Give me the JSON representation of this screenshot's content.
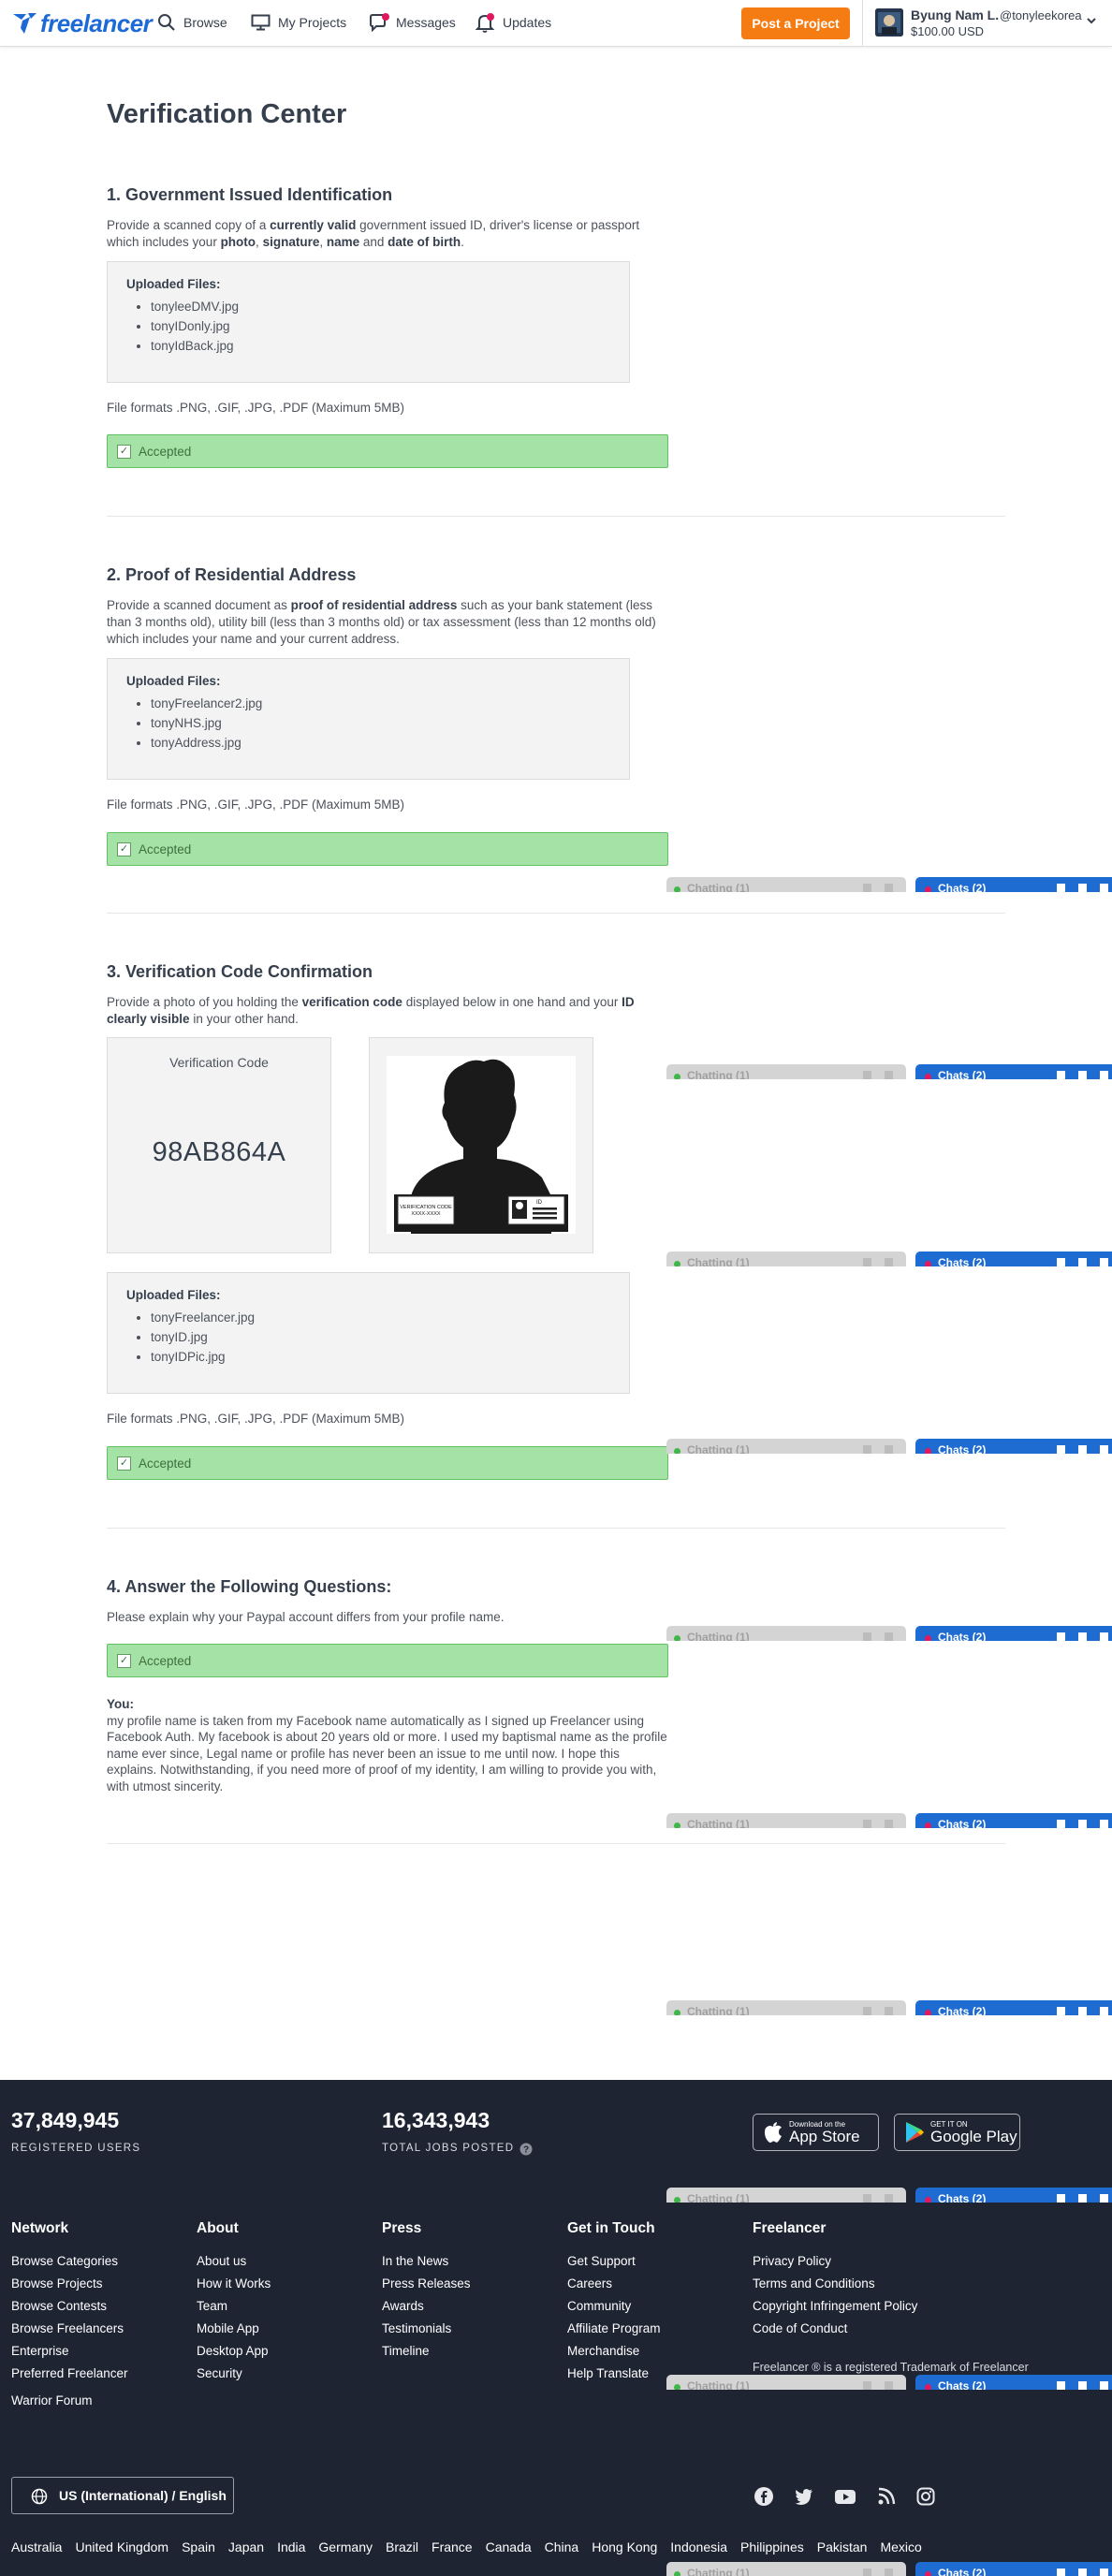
{
  "header": {
    "logo_text": "freelancer",
    "nav": [
      {
        "label": "Browse",
        "icon": "search-icon"
      },
      {
        "label": "My Projects",
        "icon": "monitor-icon"
      },
      {
        "label": "Messages",
        "icon": "chat-bubble-icon"
      },
      {
        "label": "Updates",
        "icon": "bell-icon"
      }
    ],
    "post_button": "Post a Project",
    "user": {
      "name": "Byung Nam L.",
      "handle": "@tonyleekorea",
      "balance": "$100.00 USD"
    }
  },
  "page_title": "Verification Center",
  "sections": {
    "gov_id": {
      "title": "1. Government Issued Identification",
      "desc_1": "Provide a scanned copy of a ",
      "desc_b1": "currently valid",
      "desc_2": " government issued ID, driver's license or passport which includes your ",
      "desc_b2": "photo",
      "desc_3": ", ",
      "desc_b3": "signature",
      "desc_4": ", ",
      "desc_b4": "name",
      "desc_5": " and ",
      "desc_b5": "date of birth",
      "desc_6": ".",
      "files_title": "Uploaded Files:",
      "files": [
        "tonyleeDMV.jpg",
        "tonyIDonly.jpg",
        "tonyIdBack.jpg"
      ],
      "formats": "File formats .PNG, .GIF, .JPG, .PDF (Maximum 5MB)",
      "status": "Accepted"
    },
    "address": {
      "title": "2. Proof of Residential Address",
      "desc_1": "Provide a scanned document as ",
      "desc_b1": "proof of residential address",
      "desc_2": " such as your bank statement (less than 3 months old), utility bill (less than 3 months old) or tax assessment (less than 12 months old) which includes your name and your current address.",
      "files_title": "Uploaded Files:",
      "files": [
        "tonyFreelancer2.jpg",
        "tonyNHS.jpg",
        "tonyAddress.jpg"
      ],
      "formats": "File formats .PNG, .GIF, .JPG, .PDF (Maximum 5MB)",
      "status": "Accepted"
    },
    "code": {
      "title": "3. Verification Code Confirmation",
      "desc_1": "Provide a photo of you holding the ",
      "desc_b1": "verification code",
      "desc_2": " displayed below in one hand and your ",
      "desc_b2": "ID clearly visible",
      "desc_3": " in your other hand.",
      "code_label": "Verification Code",
      "code_value": "98AB864A",
      "example_card_text": "VERIFICATION CODE",
      "example_card_code": "XXXX-XXXX",
      "example_id_text": "ID",
      "files_title": "Uploaded Files:",
      "files": [
        "tonyFreelancer.jpg",
        "tonyID.jpg",
        "tonyIDPic.jpg"
      ],
      "formats": "File formats .PNG, .GIF, .JPG, .PDF (Maximum 5MB)",
      "status": "Accepted"
    },
    "questions": {
      "title": "4. Answer the Following Questions:",
      "question": "Please explain why your Paypal account differs from your profile name.",
      "status": "Accepted",
      "you_label": "You:",
      "answer": "my profile name is taken from my Facebook name automatically as I signed up Freelancer using Facebook Auth. My facebook is about 20 years old or more. I used my baptismal name as the profile name ever since, Legal name or profile has never been an issue to me until now. I hope this explains. Notwithstanding, if you need more of proof of my identity, I am willing to provide you with, with utmost sincerity."
    }
  },
  "chat": {
    "contacts_label": "Chatting (1)",
    "chats_label": "Chats (2)"
  },
  "footer": {
    "stats": [
      {
        "value": "37,849,945",
        "label": "REGISTERED USERS"
      },
      {
        "value": "16,343,943",
        "label": "TOTAL JOBS POSTED"
      }
    ],
    "app_store": {
      "small": "Download on the",
      "big": "App Store"
    },
    "google_play": {
      "small": "GET IT ON",
      "big": "Google Play"
    },
    "columns": [
      {
        "title": "Network",
        "links": [
          "Browse Categories",
          "Browse Projects",
          "Browse Contests",
          "Browse Freelancers",
          "Enterprise",
          "Preferred Freelancer",
          "Warrior Forum"
        ]
      },
      {
        "title": "About",
        "links": [
          "About us",
          "How it Works",
          "Team",
          "Mobile App",
          "Desktop App",
          "Security"
        ]
      },
      {
        "title": "Press",
        "links": [
          "In the News",
          "Press Releases",
          "Awards",
          "Testimonials",
          "Timeline"
        ]
      },
      {
        "title": "Get in Touch",
        "links": [
          "Get Support",
          "Careers",
          "Community",
          "Affiliate Program",
          "Merchandise",
          "Help Translate"
        ]
      },
      {
        "title": "Freelancer",
        "links": [
          "Privacy Policy",
          "Terms and Conditions",
          "Copyright Infringement Policy",
          "Code of Conduct"
        ]
      }
    ],
    "trademark": "Freelancer ® is a registered Trademark of Freelancer",
    "language": "US (International) / English",
    "countries": [
      "Australia",
      "United Kingdom",
      "Spain",
      "Japan",
      "India",
      "Germany",
      "Brazil",
      "France",
      "Canada",
      "China",
      "Hong Kong",
      "Indonesia",
      "Philippines",
      "Pakistan",
      "Mexico"
    ]
  }
}
